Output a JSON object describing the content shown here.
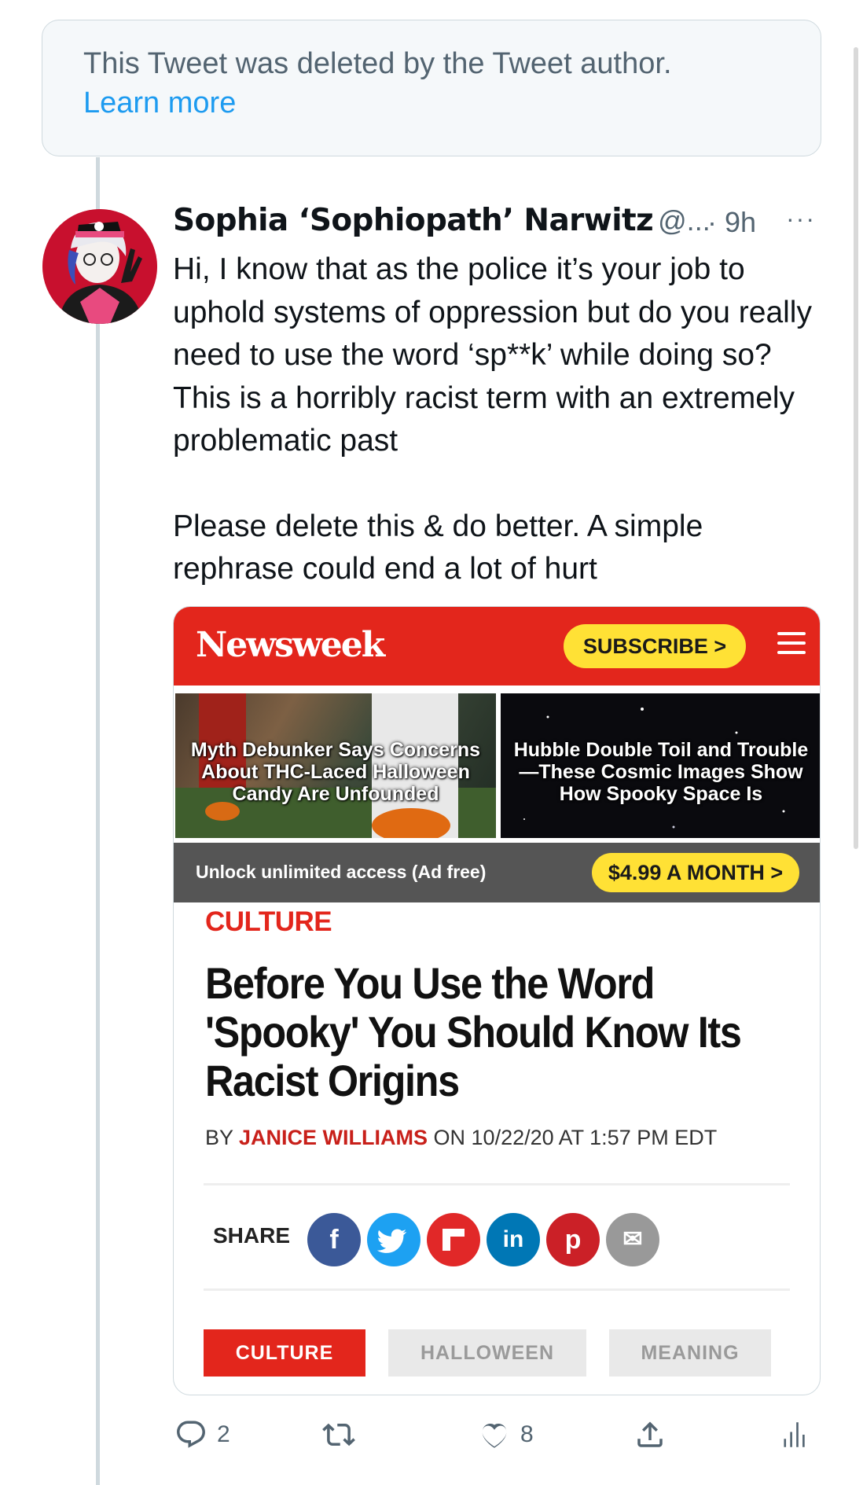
{
  "deleted_notice": {
    "message": "This Tweet was deleted by the Tweet author.",
    "link": "Learn more"
  },
  "tweet": {
    "author_name": "Sophia ‘Sophiopath’ Narwitz",
    "handle": "@...",
    "time": "· 9h",
    "more": "···",
    "paragraphs": [
      "Hi, I know that as the police it’s your job to uphold systems of oppression but do you really need to use the word ‘sp**k’ while doing so? This is a horribly racist term with an extremely problematic past",
      "Please delete this & do better. A simple rephrase could end a lot of hurt"
    ]
  },
  "card": {
    "logo": "Newsweek",
    "subscribe": "SUBSCRIBE >",
    "promo_left": "Myth Debunker Says Concerns About THC-Laced Halloween Candy Are Unfounded",
    "promo_right": "Hubble Double Toil and Trouble—These Cosmic Images Show How Spooky Space Is",
    "access_text": "Unlock unlimited access (Ad free)",
    "access_price": "$4.99 A MONTH >",
    "section": "CULTURE",
    "headline": "Before You Use the Word 'Spooky' You Should Know Its Racist Origins",
    "byline_prefix": "BY ",
    "byline_author": "JANICE WILLIAMS",
    "byline_suffix": " ON 10/22/20 AT 1:57 PM EDT",
    "share_label": "SHARE",
    "share_buttons": [
      {
        "name": "facebook",
        "glyph": "f",
        "color": "#3b5998"
      },
      {
        "name": "twitter",
        "glyph": "t",
        "color": "#1da1f2"
      },
      {
        "name": "flipboard",
        "glyph": "F",
        "color": "#e12828"
      },
      {
        "name": "linkedin",
        "glyph": "in",
        "color": "#0077b5"
      },
      {
        "name": "pinterest",
        "glyph": "p",
        "color": "#cb2027"
      },
      {
        "name": "email",
        "glyph": "✉",
        "color": "#999999"
      }
    ],
    "tags": [
      "CULTURE",
      "HALLOWEEN",
      "MEANING"
    ]
  },
  "actions": {
    "reply_count": "2",
    "like_count": "8"
  },
  "colors": {
    "accent_blue": "#1d9bf0",
    "newsweek_red": "#e3261c",
    "yellow": "#ffe135"
  }
}
